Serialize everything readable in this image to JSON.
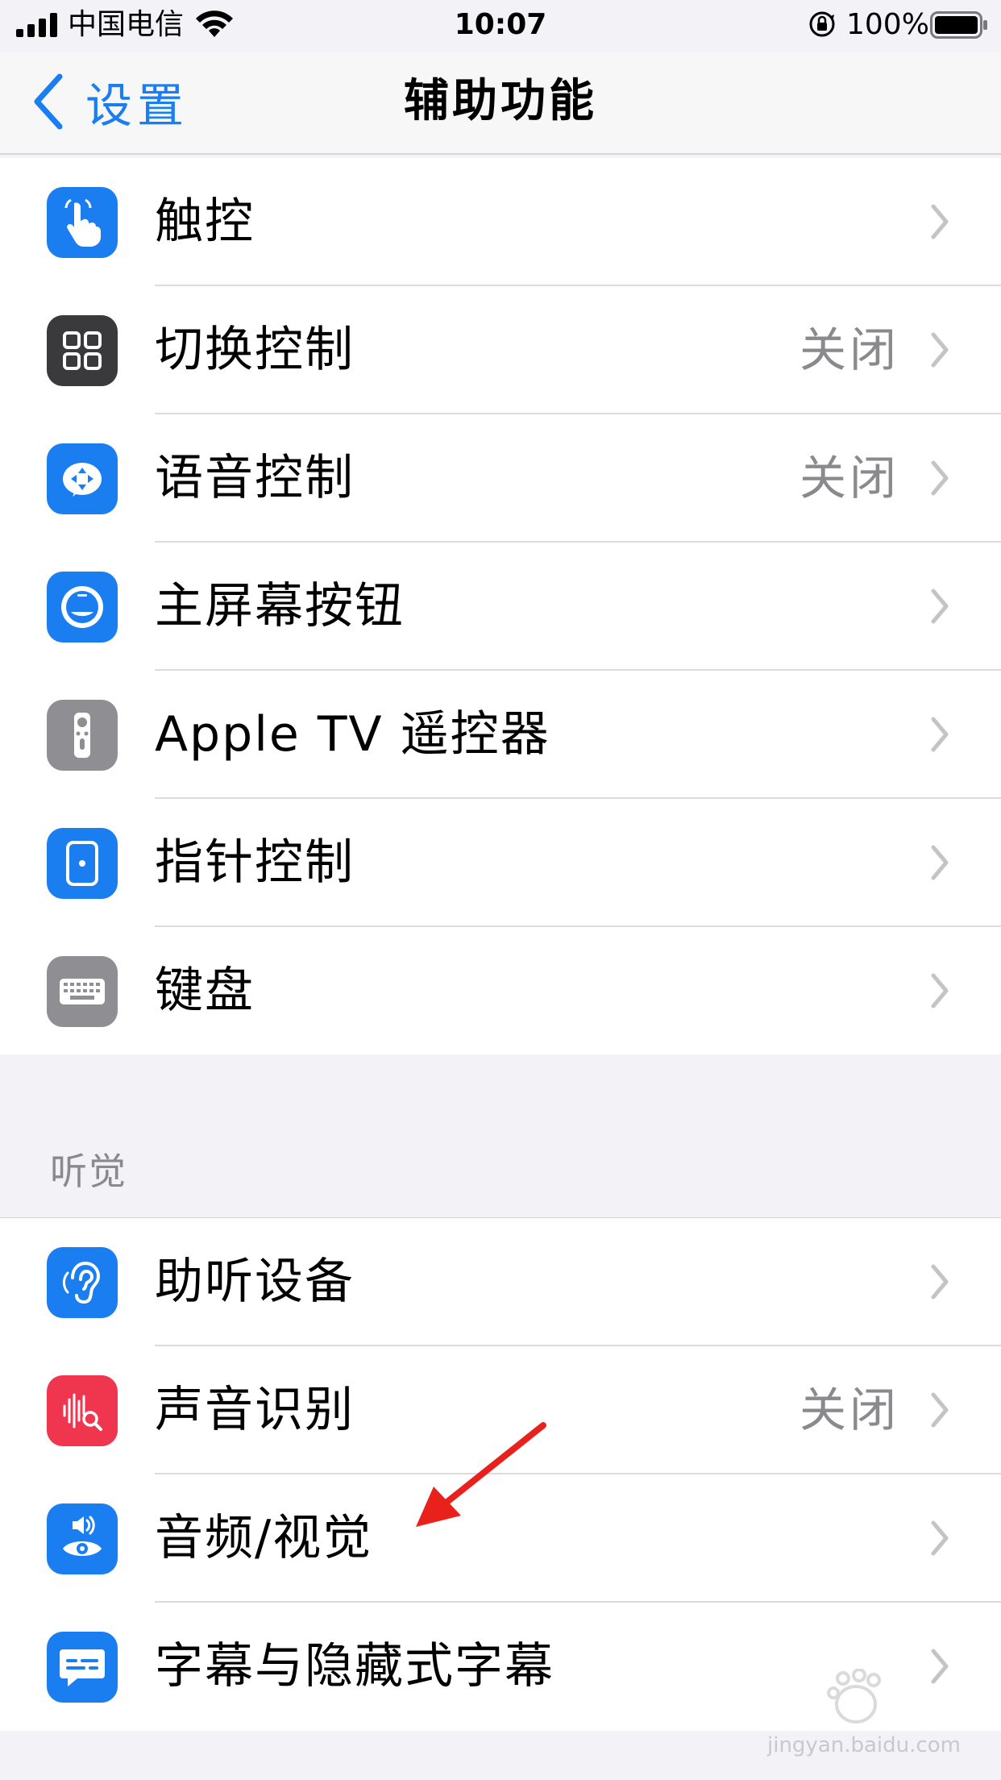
{
  "status_bar": {
    "carrier": "中国电信",
    "time": "10:07",
    "battery_percent": "100%"
  },
  "nav": {
    "back_label": "设置",
    "title": "辅助功能"
  },
  "group_1": {
    "items": [
      {
        "label": "触控",
        "value": "",
        "icon": "hand-touch-icon",
        "color": "#1a7ef0"
      },
      {
        "label": "切换控制",
        "value": "关闭",
        "icon": "grid-icon",
        "color": "#3a3a3c"
      },
      {
        "label": "语音控制",
        "value": "关闭",
        "icon": "voice-control-icon",
        "color": "#1a7ef0"
      },
      {
        "label": "主屏幕按钮",
        "value": "",
        "icon": "home-button-icon",
        "color": "#1a7ef0"
      },
      {
        "label": "Apple TV 遥控器",
        "value": "",
        "icon": "remote-icon",
        "color": "#8e8e93"
      },
      {
        "label": "指针控制",
        "value": "",
        "icon": "pointer-icon",
        "color": "#1a7ef0"
      },
      {
        "label": "键盘",
        "value": "",
        "icon": "keyboard-icon",
        "color": "#8e8e93"
      }
    ]
  },
  "section_hearing": {
    "header": "听觉"
  },
  "group_2": {
    "items": [
      {
        "label": "助听设备",
        "value": "",
        "icon": "ear-icon",
        "color": "#1a7ef0"
      },
      {
        "label": "声音识别",
        "value": "关闭",
        "icon": "sound-recognition-icon",
        "color": "#f0364f"
      },
      {
        "label": "音频/视觉",
        "value": "",
        "icon": "audio-visual-icon",
        "color": "#1a7ef0"
      },
      {
        "label": "字幕与隐藏式字幕",
        "value": "",
        "icon": "captions-icon",
        "color": "#1a7ef0"
      }
    ]
  },
  "colors": {
    "accent": "#1a7ef0",
    "annotation": "#e8211c"
  },
  "watermark": {
    "text": "jingyan.baidu.com"
  }
}
